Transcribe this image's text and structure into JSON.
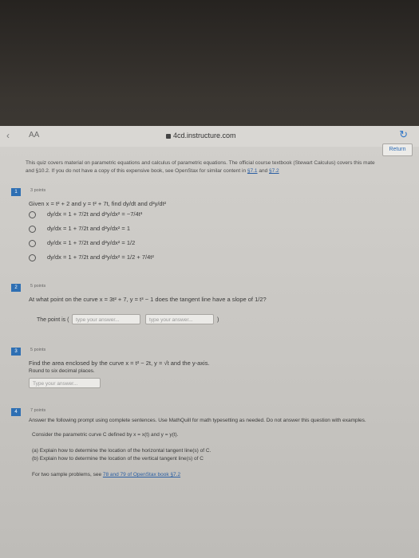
{
  "browser": {
    "back_glyph": "‹",
    "aa_label": "AA",
    "url": "4cd.instructure.com",
    "reload_glyph": "↻"
  },
  "header": {
    "return_label": "Return"
  },
  "intro": {
    "text": "This quiz covers material on parametric equations and calculus of parametric equations. The official course textbook (Stewart Calculus) covers this mate",
    "line2_prefix": "and §10.2. If you do not have a copy of this expensive book, see OpenStax for similar content in ",
    "link1": "§7.1",
    "and": " and ",
    "link2": "§7.2"
  },
  "questions": [
    {
      "number": "1",
      "points": "3 points",
      "prompt": "Given x = t² + 2 and y = t² + 7t, find dy/dt and d²y/dt²",
      "options": [
        "dy/dx = 1 + 7/2t and d²y/dx² = −7/4t³",
        "dy/dx = 1 + 7/2t and d²y/dx² = 1",
        "dy/dx = 1 + 7/2t and d²y/dx² = 1/2",
        "dy/dx = 1 + 7/2t and d²y/dx² = 1/2 + 7/4t²"
      ]
    },
    {
      "number": "2",
      "points": "5 points",
      "prompt": "At what point on the curve x = 3t² + 7, y = t³ − 1 does the tangent line have a slope of 1/2?",
      "answer_label": "The point is (",
      "placeholder1": "type your answer...",
      "placeholder2": "type your answer...",
      "close": ")"
    },
    {
      "number": "3",
      "points": "5 points",
      "prompt": "Find the area enclosed by the curve x = t² − 2t, y = √t and the y-axis.",
      "instruction": "Round to six decimal places.",
      "placeholder": "Type your answer..."
    },
    {
      "number": "4",
      "points": "7 points",
      "prompt": "Answer the following prompt using complete sentences. Use MathQuill for math typesetting as needed. Do not answer this question with examples.",
      "line2": "Consider the parametric curve C defined by x = x(t) and y = y(t).",
      "part_a": "(a) Explain how to determine the location of the horizontal tangent line(s) of C.",
      "part_b": "(b) Explain how to determine the location of the vertical tangent line(s) of C",
      "footer_prefix": "For two sample problems, see ",
      "footer_link": "78 and 79 of OpenStax book §7.2"
    }
  ]
}
